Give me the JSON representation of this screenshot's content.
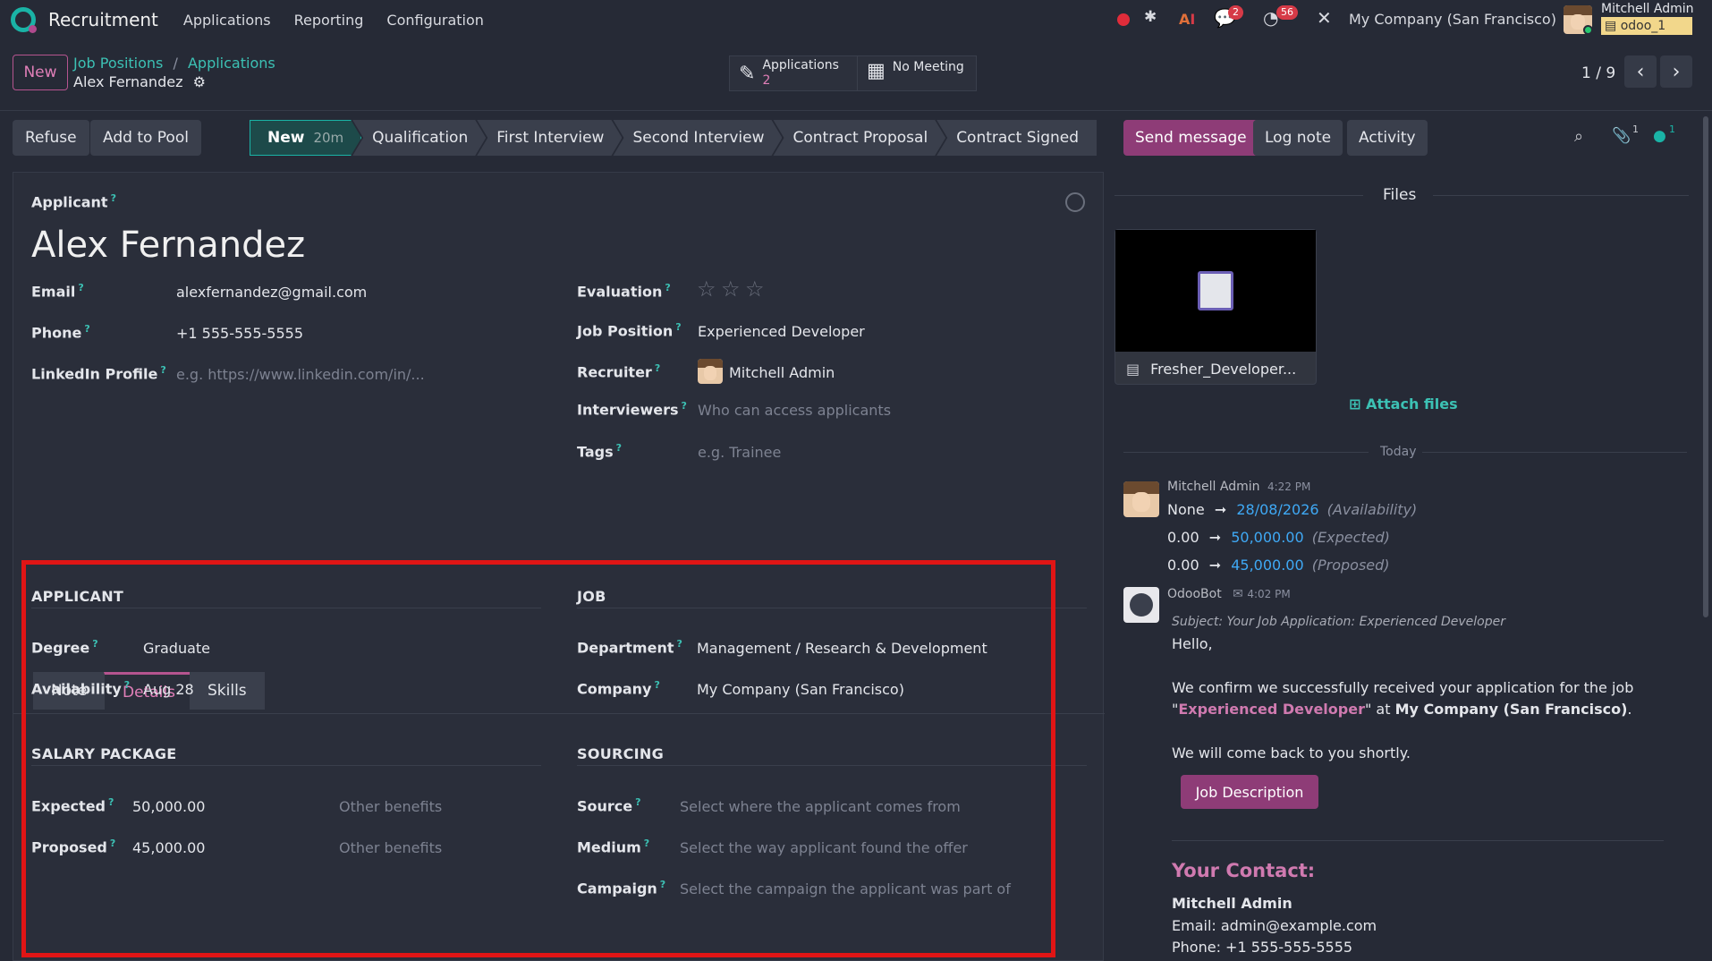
{
  "nav": {
    "app_name": "Recruitment",
    "menu": [
      "Applications",
      "Reporting",
      "Configuration"
    ],
    "messages_badge": "2",
    "activities_badge": "56",
    "company": "My Company (San Francisco)",
    "user": "Mitchell Admin",
    "database": "odoo_1"
  },
  "control_panel": {
    "new_button": "New",
    "breadcrumb": [
      "Job Positions",
      "Applications"
    ],
    "record_name": "Alex Fernandez",
    "stat_applications_label": "Applications",
    "stat_applications_count": "2",
    "stat_meeting_label": "No Meeting",
    "pager": "1 / 9"
  },
  "actions": {
    "refuse": "Refuse",
    "add_to_pool": "Add to Pool"
  },
  "pipeline": {
    "stages": [
      "New",
      "Qualification",
      "First Interview",
      "Second Interview",
      "Contract Proposal",
      "Contract Signed"
    ],
    "active": "New",
    "timer": "20m"
  },
  "form": {
    "applicant_label": "Applicant",
    "name": "Alex Fernandez",
    "email_label": "Email",
    "email": "alexfernandez@gmail.com",
    "phone_label": "Phone",
    "phone": "+1 555-555-5555",
    "linkedin_label": "LinkedIn Profile",
    "linkedin_placeholder": "e.g. https://www.linkedin.com/in/...",
    "evaluation_label": "Evaluation",
    "evaluation_stars": 0,
    "job_position_label": "Job Position",
    "job_position": "Experienced Developer",
    "recruiter_label": "Recruiter",
    "recruiter": "Mitchell Admin",
    "interviewers_label": "Interviewers",
    "interviewers_placeholder": "Who can access applicants",
    "tags_label": "Tags",
    "tags_placeholder": "e.g. Trainee",
    "tabs": [
      "Note",
      "Details",
      "Skills"
    ],
    "active_tab": "Details"
  },
  "details": {
    "applicant_heading": "APPLICANT",
    "degree_label": "Degree",
    "degree": "Graduate",
    "availability_label": "Availability",
    "availability": "Aug 28",
    "salary_heading": "SALARY PACKAGE",
    "expected_label": "Expected",
    "expected": "50,000.00",
    "expected_other": "Other benefits",
    "proposed_label": "Proposed",
    "proposed": "45,000.00",
    "proposed_other": "Other benefits",
    "job_heading": "JOB",
    "department_label": "Department",
    "department": "Management / Research & Development",
    "company_label": "Company",
    "company": "My Company (San Francisco)",
    "sourcing_heading": "SOURCING",
    "source_label": "Source",
    "source_placeholder": "Select where the applicant comes from",
    "medium_label": "Medium",
    "medium_placeholder": "Select the way applicant found the offer",
    "campaign_label": "Campaign",
    "campaign_placeholder": "Select the campaign the applicant was part of"
  },
  "chatter": {
    "send_message": "Send message",
    "log_note": "Log note",
    "activity": "Activity",
    "attachments_count": "1",
    "followers_count": "1",
    "files_heading": "Files",
    "file_name": "Fresher_Developer...",
    "attach_files": "Attach files",
    "today": "Today",
    "msg1": {
      "author": "Mitchell Admin",
      "time": "4:22 PM",
      "changes": [
        {
          "old": "None",
          "new": "28/08/2026",
          "field": "(Availability)"
        },
        {
          "old": "0.00",
          "new": "50,000.00",
          "field": "(Expected)"
        },
        {
          "old": "0.00",
          "new": "45,000.00",
          "field": "(Proposed)"
        }
      ]
    },
    "msg2": {
      "author": "OdooBot",
      "time": "4:02 PM",
      "subject": "Subject: Your Job Application: Experienced Developer",
      "hello": "Hello,",
      "line1": "We confirm we successfully received your application for the job",
      "job_q_open": "\"",
      "job": "Experienced Developer",
      "job_q_close": "\" at ",
      "company": "My Company (San Francisco)",
      "period": ".",
      "line3": "We will come back to you shortly.",
      "button": "Job Description",
      "contact_heading": "Your Contact:",
      "contact_name": "Mitchell Admin",
      "contact_email": "Email: admin@example.com",
      "contact_phone": "Phone: +1 555-555-5555"
    }
  }
}
